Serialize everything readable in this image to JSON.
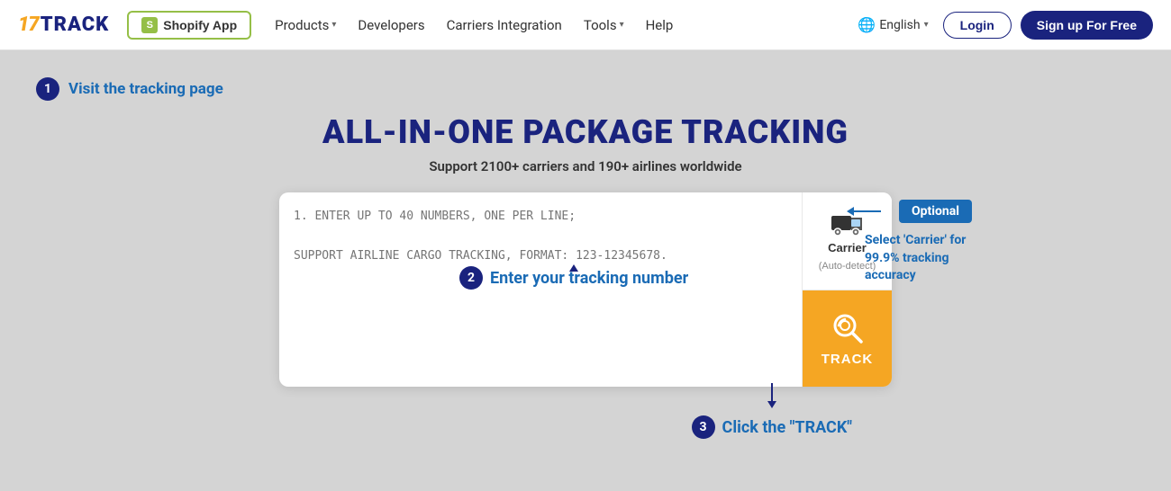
{
  "header": {
    "logo": {
      "part1": "17",
      "part2": "TRACK"
    },
    "shopify_btn": "Shopify App",
    "nav": [
      {
        "label": "Products",
        "has_arrow": true
      },
      {
        "label": "Developers",
        "has_arrow": false
      },
      {
        "label": "Carriers Integration",
        "has_arrow": false
      },
      {
        "label": "Tools",
        "has_arrow": true
      },
      {
        "label": "Help",
        "has_arrow": false
      }
    ],
    "lang": {
      "label": "English",
      "has_arrow": true
    },
    "login_label": "Login",
    "signup_label": "Sign up For Free"
  },
  "main": {
    "step1": {
      "number": "1",
      "label": "Visit the tracking page"
    },
    "title": "ALL-IN-ONE PACKAGE TRACKING",
    "subtitle": "Support 2100+ carriers and 190+ airlines worldwide",
    "textarea_placeholder": "1. ENTER UP TO 40 NUMBERS, ONE PER LINE;\n\nSUPPORT AIRLINE CARGO TRACKING, FORMAT: 123-12345678.",
    "carrier_label": "Carrier",
    "carrier_sub": "(Auto-detect)",
    "track_label": "TRACK",
    "optional_badge": "Optional",
    "optional_text": "Select 'Carrier' for 99.9% tracking accuracy",
    "step2": {
      "number": "2",
      "label": "Enter your tracking number"
    },
    "step3": {
      "number": "3",
      "label": "Click the \"TRACK\""
    }
  }
}
